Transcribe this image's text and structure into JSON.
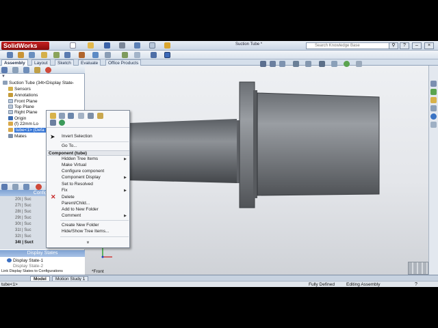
{
  "app": {
    "logo": "SolidWorks",
    "document_title": "Suction Tube *",
    "search_placeholder": "Search Knowledge Base"
  },
  "command_tabs": [
    "Assembly",
    "Layout",
    "Sketch",
    "Evaluate",
    "Office Products"
  ],
  "tree": {
    "root": "Suction Tube  (34t<Display State-",
    "items": [
      "Sensors",
      "Annotations",
      "Front Plane",
      "Top Plane",
      "Right Plane",
      "Origin",
      "(f) 22mm Lo",
      "tube<1> (Defa",
      "Mates"
    ]
  },
  "context_menu": {
    "items_top": [
      "Invert Selection",
      "Go To..."
    ],
    "header": "Component (tube)",
    "items": [
      {
        "label": "Hidden Tree Items",
        "arrow": true
      },
      {
        "label": "Make Virtual",
        "arrow": false
      },
      {
        "label": "Configure component",
        "arrow": false
      },
      {
        "label": "Component Display",
        "arrow": true
      },
      {
        "label": "Set to Resolved",
        "arrow": false
      },
      {
        "label": "Fix",
        "arrow": true
      },
      {
        "label": "Delete",
        "arrow": false
      },
      {
        "label": "Parent/Child...",
        "arrow": false
      },
      {
        "label": "Add to New Folder",
        "arrow": false
      },
      {
        "label": "Comment",
        "arrow": true
      },
      {
        "label": "Create New Folder",
        "arrow": false
      },
      {
        "label": "Hide/Show Tree Items...",
        "arrow": false
      }
    ],
    "more": "»"
  },
  "config_panel": {
    "title": "Configur",
    "items": [
      "20t | Suc",
      "27t | Suc",
      "28t | Suc",
      "29t | Suc",
      "30t | Suc",
      "31t | Suc",
      "32t | Suc",
      "34t | Suct"
    ]
  },
  "display_states": {
    "title": "Display States",
    "items": [
      "Display State-1",
      "Display State-2"
    ],
    "link_label": "Link Display States to Configurations"
  },
  "viewport": {
    "view_label": "*Front"
  },
  "bottom_tabs": [
    "Model",
    "Motion Study 1"
  ],
  "status": {
    "left": "tube<1>",
    "state": "Fully Defined",
    "mode": "Editing Assembly"
  },
  "colors": {
    "accent": "#3877d6",
    "part_dark": "#4a4d51",
    "part_light": "#8c9095"
  }
}
